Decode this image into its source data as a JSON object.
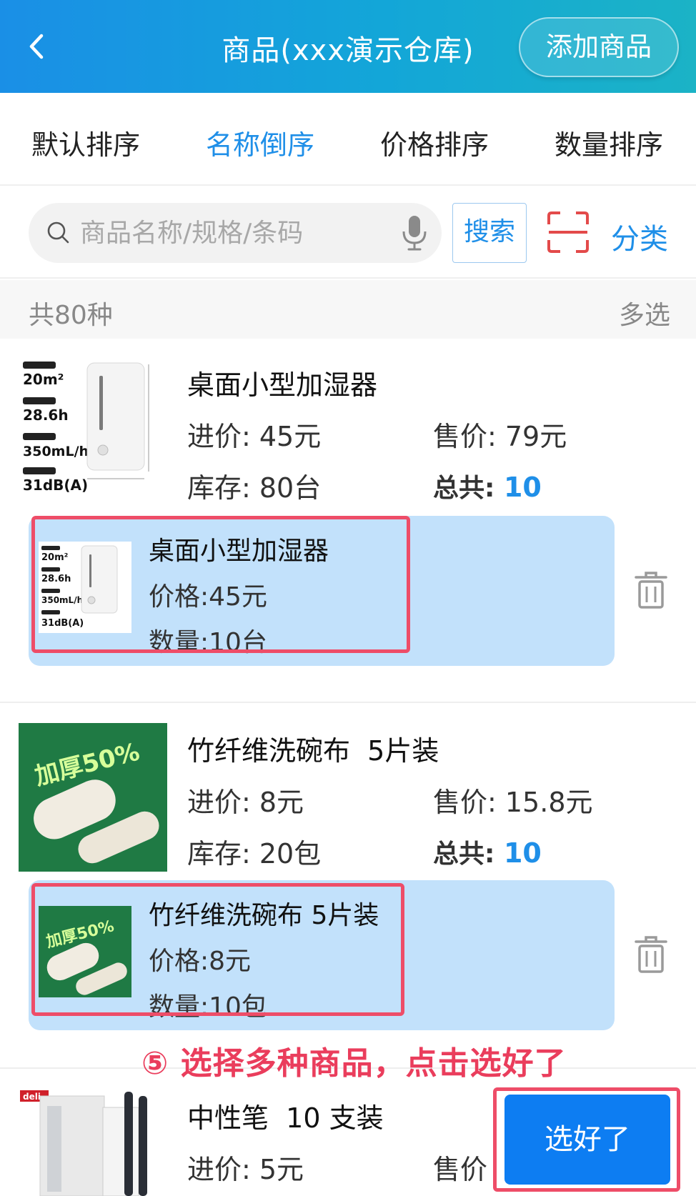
{
  "header": {
    "title": "商品(xxx演示仓库)",
    "add_label": "添加商品"
  },
  "sort_tabs": [
    {
      "label": "默认排序",
      "active": false
    },
    {
      "label": "名称倒序",
      "active": true
    },
    {
      "label": "价格排序",
      "active": false
    },
    {
      "label": "数量排序",
      "active": false
    }
  ],
  "search": {
    "placeholder": "商品名称/规格/条码",
    "button_label": "搜索",
    "category_label": "分类"
  },
  "list": {
    "count_text": "共80种",
    "multi_select_label": "多选"
  },
  "products": [
    {
      "name": "桌面小型加湿器",
      "purchase_price": "进价: 45元",
      "sale_price": "售价: 79元",
      "stock": "库存: 80台",
      "total_label": "总共:",
      "total_value": "10",
      "image_specs": [
        "20m²",
        "28.6h",
        "350mL/h",
        "31dB(A)"
      ],
      "selected": {
        "name": "桌面小型加湿器",
        "price": "价格:45元",
        "quantity": "数量:10台"
      }
    },
    {
      "name": "竹纤维洗碗布  5片装",
      "purchase_price": "进价: 8元",
      "sale_price": "售价: 15.8元",
      "stock": "库存: 20包",
      "total_label": "总共:",
      "total_value": "10",
      "image_text": "加厚50%",
      "selected": {
        "name": "竹纤维洗碗布 5片装",
        "price": "价格:8元",
        "quantity": "数量:10包"
      }
    },
    {
      "name": "中性笔  10 支装",
      "purchase_price": "进价: 5元",
      "sale_price": "售价",
      "brand": "deli"
    }
  ],
  "annotation": "⑤ 选择多种商品，点击选好了",
  "done_label": "选好了",
  "colors": {
    "accent": "#1f8fe8",
    "highlight": "#ee4d68",
    "selected_bg": "#c2e1fb",
    "done": "#0d7df2"
  }
}
